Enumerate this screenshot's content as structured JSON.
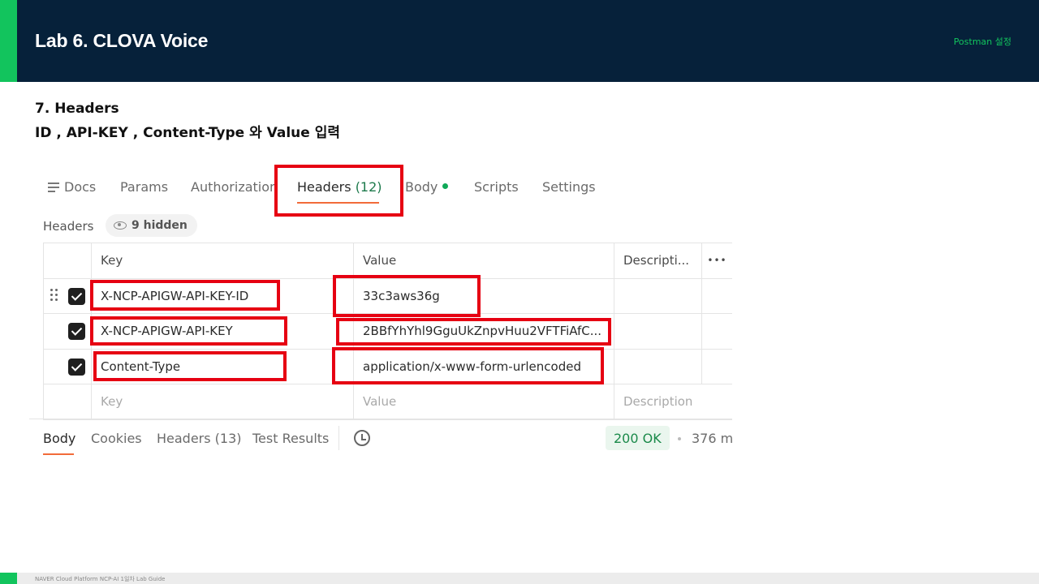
{
  "slide": {
    "title": "Lab 6. CLOVA Voice",
    "section": "Postman 설정",
    "step_title": "7. Headers",
    "step_desc": "ID , API-KEY , Content-Type 와 Value 입력",
    "footer": "NAVER Cloud Platform  NCP-AI 1일차 Lab Guide"
  },
  "request_tabs": {
    "docs": "Docs",
    "params": "Params",
    "authorization": "Authorization",
    "headers": "Headers",
    "headers_count": "(12)",
    "body": "Body",
    "scripts": "Scripts",
    "settings": "Settings"
  },
  "headers_panel": {
    "label": "Headers",
    "hidden": "9 hidden",
    "columns": {
      "key": "Key",
      "value": "Value",
      "description": "Descripti...",
      "more": "•••"
    },
    "rows": [
      {
        "key": "X-NCP-APIGW-API-KEY-ID",
        "value": "33c3aws36g",
        "checked": true
      },
      {
        "key": "X-NCP-APIGW-API-KEY",
        "value": "2BBfYhYhl9GguUkZnpvHuu2VFTFiAfC...",
        "checked": true
      },
      {
        "key": "Content-Type",
        "value": "application/x-www-form-urlencoded",
        "checked": true
      }
    ],
    "placeholder": {
      "key": "Key",
      "value": "Value",
      "description": "Description"
    }
  },
  "response_bar": {
    "body": "Body",
    "cookies": "Cookies",
    "headers": "Headers (13)",
    "test_results": "Test Results",
    "status": "200 OK",
    "time": "376 m"
  },
  "colors": {
    "title_bar": "#06213a",
    "accent_green": "#12c45d",
    "highlight_red": "#e60012",
    "tab_underline": "#f26b3a"
  },
  "icons": [
    "docs-icon",
    "eye-icon",
    "drag-handle-icon",
    "checkbox-icon",
    "more-icon",
    "history-icon"
  ]
}
